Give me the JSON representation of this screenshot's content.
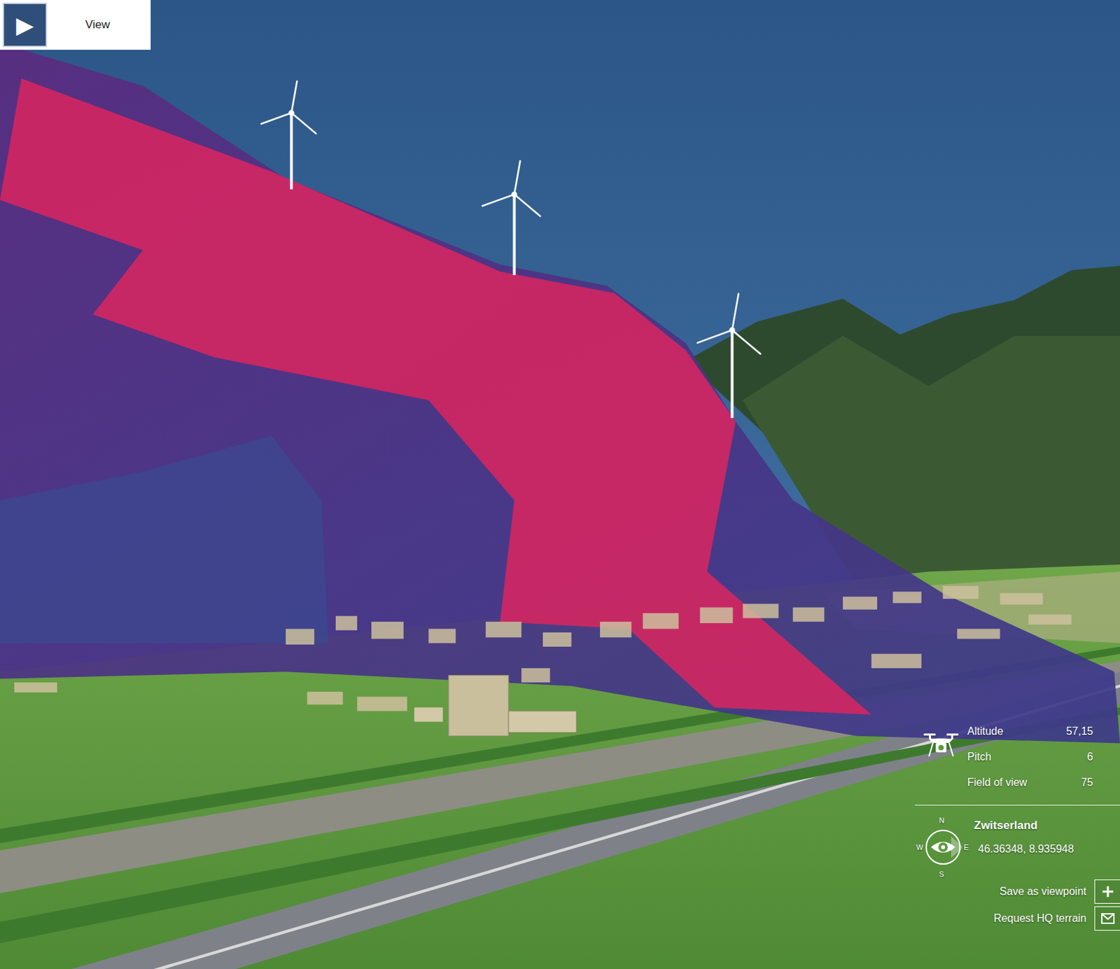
{
  "view_button": {
    "icon": "▶",
    "label": "View"
  },
  "camera": [
    {
      "label": "Altitude",
      "value": "57,15"
    },
    {
      "label": "Pitch",
      "value": "6"
    },
    {
      "label": "Field of view",
      "value": "75"
    }
  ],
  "location": {
    "name": "Zwitserland",
    "coordinates": "46.36348, 8.935948"
  },
  "compass": {
    "north": "N",
    "east": "E",
    "south": "S",
    "west": "W"
  },
  "actions": [
    {
      "label": "Save as viewpoint",
      "kind": "plus"
    },
    {
      "label": "Request HQ terrain",
      "kind": "mail"
    }
  ]
}
